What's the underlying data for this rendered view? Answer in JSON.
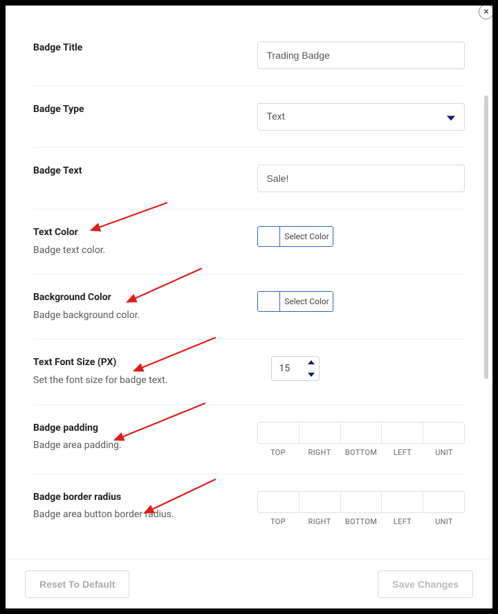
{
  "close": "×",
  "fields": {
    "title": {
      "label": "Badge Title",
      "value": "Trading Badge"
    },
    "type": {
      "label": "Badge Type",
      "value": "Text"
    },
    "text": {
      "label": "Badge Text",
      "value": "Sale!"
    },
    "text_color": {
      "label": "Text Color",
      "desc": "Badge text color.",
      "button": "Select Color",
      "swatch": "#ffffff"
    },
    "bg_color": {
      "label": "Background Color",
      "desc": "Badge background color.",
      "button": "Select Color",
      "swatch": "#ffffff"
    },
    "font_size": {
      "label": "Text Font Size (PX)",
      "desc": "Set the font size for badge text.",
      "value": "15"
    },
    "padding": {
      "label": "Badge padding",
      "desc": "Badge area padding.",
      "sublabels": [
        "TOP",
        "RIGHT",
        "BOTTOM",
        "LEFT",
        "UNIT"
      ]
    },
    "radius": {
      "label": "Badge border radius",
      "desc": "Badge area button border radius.",
      "sublabels": [
        "TOP",
        "RIGHT",
        "BOTTOM",
        "LEFT",
        "UNIT"
      ]
    }
  },
  "footer": {
    "reset": "Reset To Default",
    "save": "Save Changes"
  }
}
